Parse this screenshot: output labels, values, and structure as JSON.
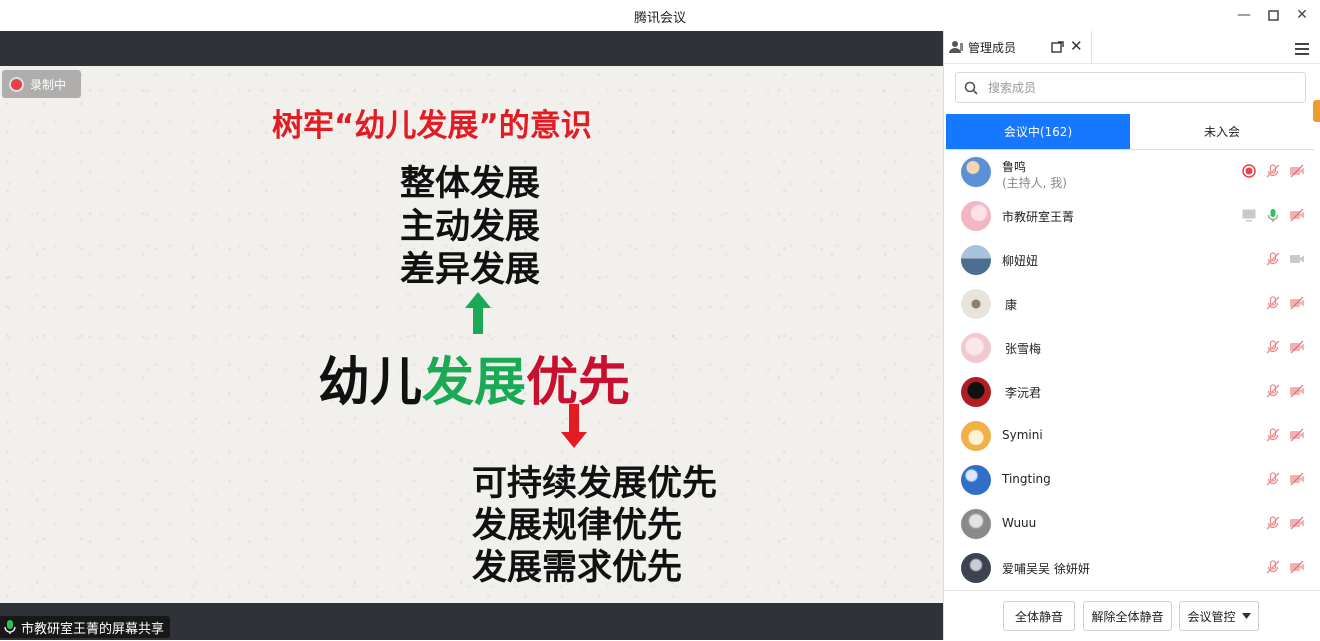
{
  "window": {
    "title": "腾讯会议"
  },
  "recording": {
    "label": "录制中"
  },
  "slide": {
    "title": "树牢“幼儿发展”的意识",
    "upper_lines": [
      "整体发展",
      "主动发展",
      "差异发展"
    ],
    "center": {
      "part1": "幼儿",
      "part2": "发展",
      "part3": "优先"
    },
    "lower_lines": [
      "可持续发展优先",
      "发展规律优先",
      "发展需求优先"
    ]
  },
  "share_label": "市教研室王菁的屏幕共享",
  "panel": {
    "tab_label": "管理成员",
    "search_placeholder": "搜索成员",
    "segments": [
      {
        "label": "会议中(162)",
        "active": true
      },
      {
        "label": "未入会",
        "active": false
      }
    ],
    "members": [
      {
        "name": "鲁鸣",
        "sub": "(主持人, 我)",
        "avatar_color": "#5b8fd6"
      },
      {
        "name": "市教研室王菁",
        "sub": "",
        "avatar_color": "#f2b6c2"
      },
      {
        "name": "柳妞妞",
        "sub": "",
        "avatar_color": "#4e6e8f"
      },
      {
        "name": "康",
        "sub": "",
        "avatar_color": "#d9d3c8"
      },
      {
        "name": "张雪梅",
        "sub": "",
        "avatar_color": "#f0c9cf"
      },
      {
        "name": "李沅君",
        "sub": "",
        "avatar_color": "#b01e24"
      },
      {
        "name": "Symini",
        "sub": "",
        "avatar_color": "#f2b04a"
      },
      {
        "name": "Tingting",
        "sub": "",
        "avatar_color": "#2f6fc8"
      },
      {
        "name": "Wuuu",
        "sub": "",
        "avatar_color": "#8a8a8a"
      },
      {
        "name": "爱哺吴吴 徐妍妍",
        "sub": "",
        "avatar_color": "#3b4350"
      }
    ],
    "footer": {
      "mute_all": "全体静音",
      "unmute_all": "解除全体静音",
      "control": "会议管控"
    }
  },
  "colors": {
    "accent_blue": "#1677ff",
    "slide_red": "#e31b23",
    "slide_green": "#1aaa55",
    "muted_red": "#f08a8a"
  }
}
